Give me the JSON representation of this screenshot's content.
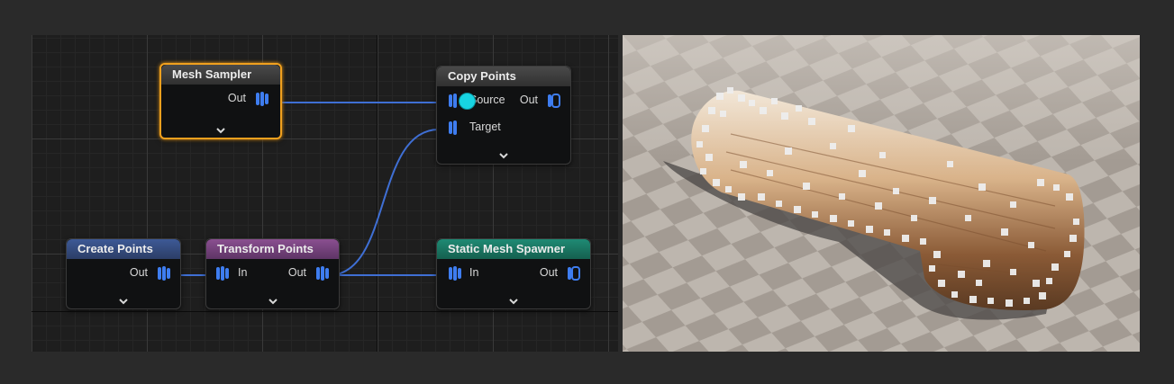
{
  "colors": {
    "wire": "#3f6fd4",
    "pin": "#3e7df0",
    "selection": "#f0a01e",
    "anchor": "#17d4e2"
  },
  "nodes": {
    "mesh_sampler": {
      "title": "Mesh Sampler",
      "out": "Out"
    },
    "copy_points": {
      "title": "Copy Points",
      "source": "Source",
      "out": "Out",
      "target": "Target"
    },
    "create_points": {
      "title": "Create Points",
      "out": "Out"
    },
    "transform_points": {
      "title": "Transform Points",
      "in": "In",
      "out": "Out"
    },
    "static_mesh_spawner": {
      "title": "Static Mesh Spawner",
      "in": "In",
      "out": "Out"
    }
  },
  "icons": {
    "pin": "point-data-pin-icon",
    "expand": "chevron-down-icon"
  }
}
